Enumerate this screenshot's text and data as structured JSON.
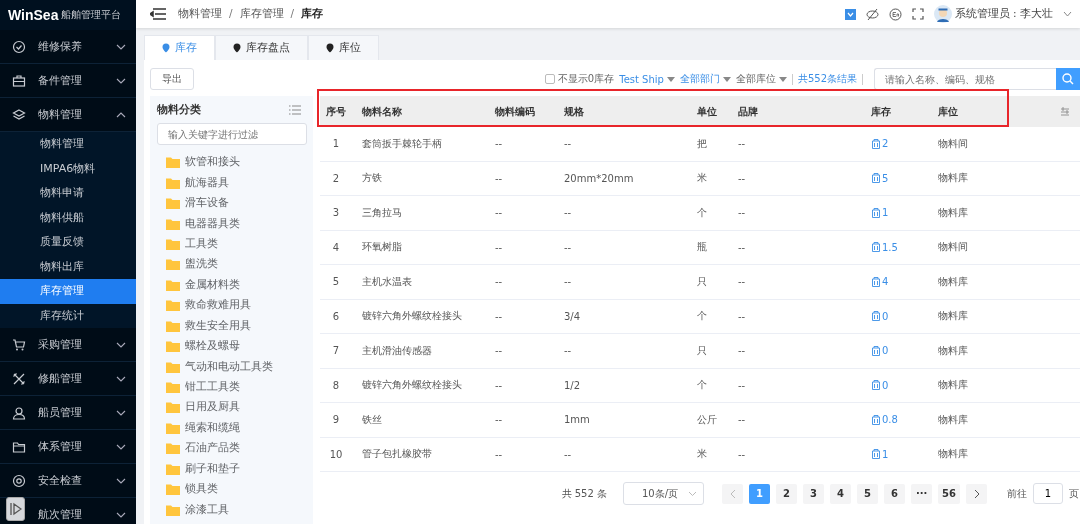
{
  "app": {
    "logo": "WinSea",
    "subtitle": "船舶管理平台"
  },
  "sidebar": {
    "items": [
      {
        "label": "维修保养",
        "expanded": false
      },
      {
        "label": "备件管理",
        "expanded": false
      },
      {
        "label": "物料管理",
        "expanded": true,
        "children": [
          {
            "label": "物料管理",
            "selected": false
          },
          {
            "label": "IMPA6物料",
            "selected": false
          },
          {
            "label": "物料申请",
            "selected": false
          },
          {
            "label": "物料供船",
            "selected": false
          },
          {
            "label": "质量反馈",
            "selected": false
          },
          {
            "label": "物料出库",
            "selected": false
          },
          {
            "label": "库存管理",
            "selected": true
          },
          {
            "label": "库存统计",
            "selected": false
          }
        ]
      },
      {
        "label": "采购管理",
        "expanded": false
      },
      {
        "label": "修船管理",
        "expanded": false
      },
      {
        "label": "船员管理",
        "expanded": false
      },
      {
        "label": "体系管理",
        "expanded": false
      },
      {
        "label": "安全检查",
        "expanded": false
      },
      {
        "label": "航次管理",
        "expanded": false
      }
    ]
  },
  "header": {
    "breadcrumb": [
      "物料管理",
      "库存管理",
      "库存"
    ],
    "separator": "/",
    "user": "系统管理员 : 李大壮"
  },
  "tabs": [
    {
      "label": "库存",
      "selected": true
    },
    {
      "label": "库存盘点",
      "selected": false
    },
    {
      "label": "库位",
      "selected": false
    }
  ],
  "toolbar": {
    "export_button": "导出",
    "hide_zero": {
      "label": "不显示0库存",
      "checked": false
    },
    "filters": [
      {
        "label": "Test Ship",
        "active": true
      },
      {
        "label": "全部部门",
        "active": true
      },
      {
        "label": "全部库位",
        "active": false
      }
    ],
    "result_count": "共552条结果",
    "search": {
      "placeholder": "请输入名称、编码、规格"
    }
  },
  "category_panel": {
    "title": "物料分类",
    "filter": {
      "placeholder": "输入关键字进行过滤"
    },
    "items": [
      "软管和接头",
      "航海器具",
      "滑车设备",
      "电器器具类",
      "工具类",
      "盥洗类",
      "金属材料类",
      "救命救难用具",
      "救生安全用具",
      "螺栓及螺母",
      "气动和电动工具类",
      "钳工工具类",
      "日用及厨具",
      "绳索和缆绳",
      "石油产品类",
      "刷子和垫子",
      "锁具类",
      "涂漆工具"
    ]
  },
  "table": {
    "columns": [
      "序号",
      "物料名称",
      "物料编码",
      "规格",
      "单位",
      "品牌",
      "库存",
      "库位"
    ],
    "rows": [
      [
        "1",
        "套筒扳手棘轮手柄",
        "--",
        "--",
        "把",
        "--",
        "2",
        "物料间"
      ],
      [
        "2",
        "方铁",
        "--",
        "20mm*20mm",
        "米",
        "--",
        "5",
        "物料库"
      ],
      [
        "3",
        "三角拉马",
        "--",
        "--",
        "个",
        "--",
        "1",
        "物料库"
      ],
      [
        "4",
        "环氧树脂",
        "--",
        "--",
        "瓶",
        "--",
        "1.5",
        "物料间"
      ],
      [
        "5",
        "主机水温表",
        "--",
        "--",
        "只",
        "--",
        "4",
        "物料库"
      ],
      [
        "6",
        "镀锌六角外螺纹栓接头",
        "--",
        "3/4",
        "个",
        "--",
        "0",
        "物料库"
      ],
      [
        "7",
        "主机滑油传感器",
        "--",
        "--",
        "只",
        "--",
        "0",
        "物料库"
      ],
      [
        "8",
        "镀锌六角外螺纹栓接头",
        "--",
        "1/2",
        "个",
        "--",
        "0",
        "物料库"
      ],
      [
        "9",
        "铁丝",
        "--",
        "1mm",
        "公斤",
        "--",
        "0.8",
        "物料库"
      ],
      [
        "10",
        "管子包扎橡胶带",
        "--",
        "--",
        "米",
        "--",
        "1",
        "物料库"
      ]
    ]
  },
  "pagination": {
    "total": "共 552 条",
    "page_size": "10条/页",
    "pages": [
      {
        "label": "1",
        "selected": true
      },
      {
        "label": "2",
        "selected": false
      },
      {
        "label": "3",
        "selected": false
      },
      {
        "label": "4",
        "selected": false
      },
      {
        "label": "5",
        "selected": false
      },
      {
        "label": "6",
        "selected": false
      },
      {
        "label": "···",
        "selected": false
      },
      {
        "label": "56",
        "selected": false
      }
    ],
    "goto_label": "前往",
    "goto_value": "1",
    "goto_suffix": "页"
  }
}
